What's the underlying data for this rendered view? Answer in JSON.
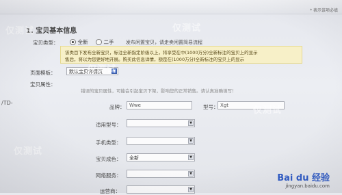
{
  "page": {
    "required_hint": "* 表示该项必填",
    "section_title": "1. 宝贝基本信息",
    "td_label": "/TD-"
  },
  "item_type": {
    "label": "宝贝类型：",
    "option_new": "全新",
    "option_used": "二手",
    "idle_link_text": "发布闲置宝贝，请走卖闲置简易流程"
  },
  "notice": {
    "line1": "该类目下发布全新宝贝，标注全新指定阶级以上，将享受在中(1000万分)全新标注的宝贝上的显示",
    "line2": "售后，将以为您更好地开展。购买此信息详情，额是在(1000万分)全新标注的宝贝上的显示"
  },
  "template": {
    "label": "页面模板：",
    "selected": "默认宝贝详情页"
  },
  "attributes": {
    "label": "宝贝属性：",
    "hint": "错误的宝贝属性，可能会引起宝贝下架，影响您的正常销售。请认真准确填写！"
  },
  "fields": {
    "brand_label": "品牌：",
    "brand_value": "Wwe",
    "model_label": "型号：",
    "model_value": "Xgt",
    "applicable_model_label": "适用型号：",
    "phone_type_label": "手机类型：",
    "color_label": "宝贝成色：",
    "color_value": "全新",
    "network_label": "网络服务：",
    "operator_label": "运营商："
  },
  "watermarks": [
    "仅测试",
    "仅测试",
    "仅测试",
    "仅测试",
    "仅测试"
  ],
  "branding": {
    "logo": "Bai du 经验",
    "url": "jingyan.baidu.com"
  },
  "colors": {
    "notice_bg": "#f7f0c8",
    "select_arrow_blue": "#5a7ecf",
    "baidu_blue": "#2b58c5"
  }
}
